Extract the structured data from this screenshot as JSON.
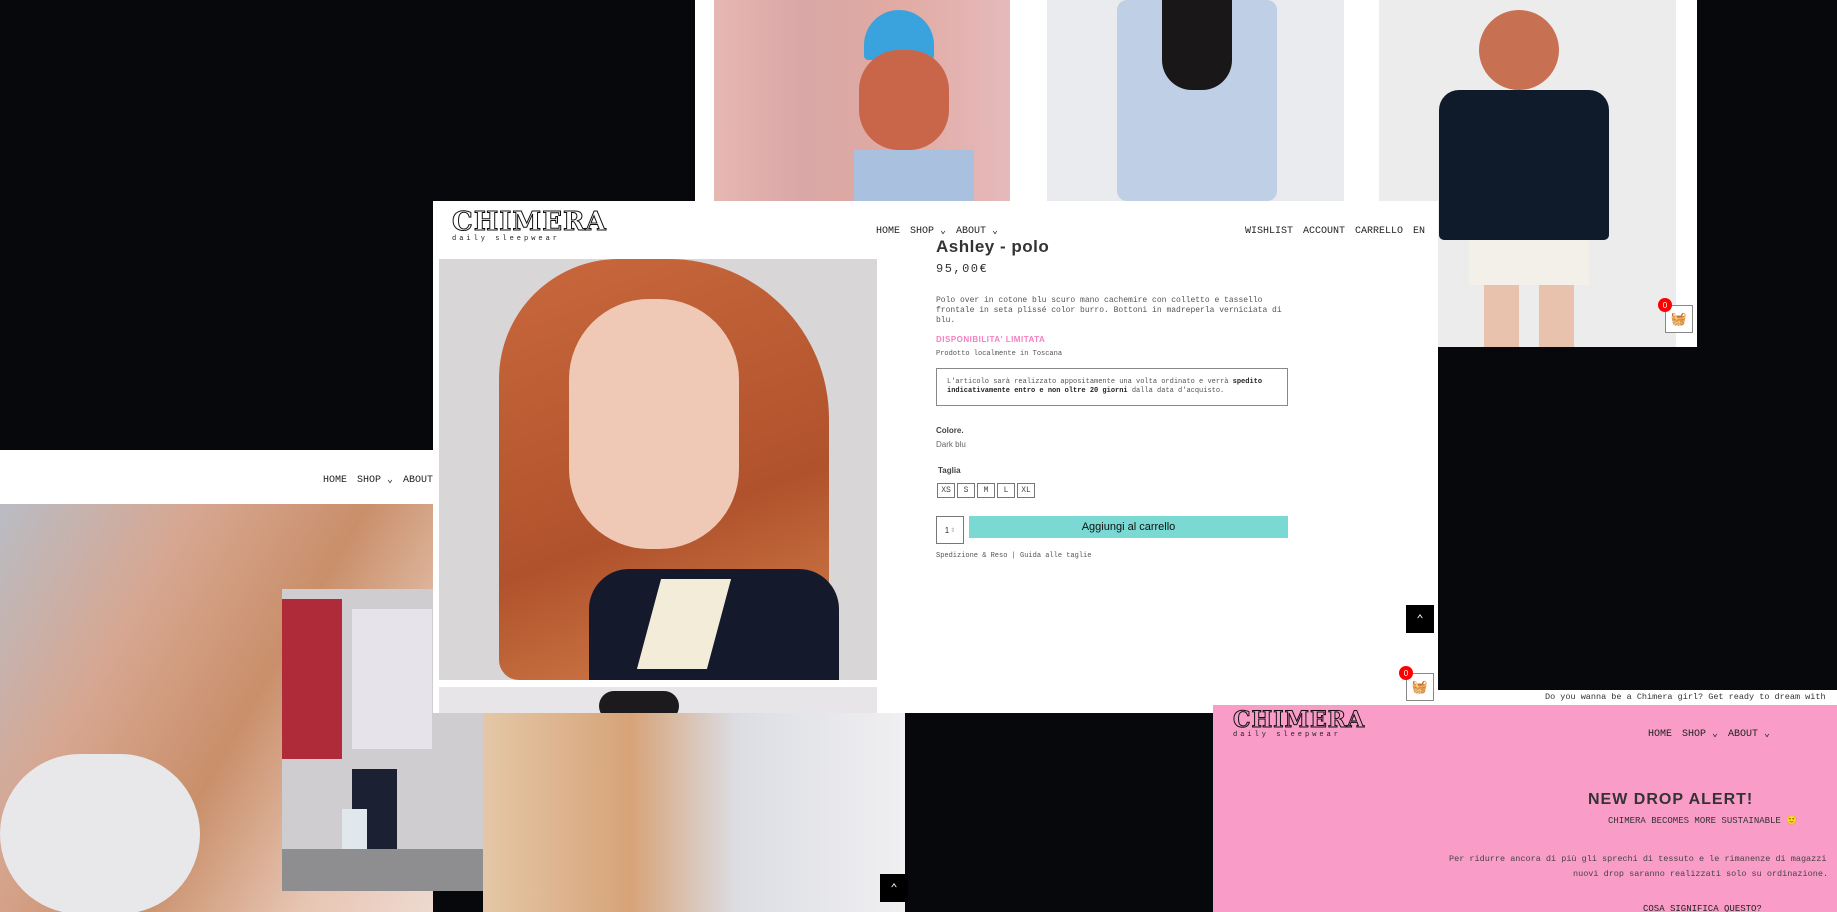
{
  "brand": {
    "logo": "CHIMERA",
    "tagline": "daily sleepwear"
  },
  "nav": {
    "home": "HOME",
    "shop": "SHOP ⌄",
    "about": "ABOUT ⌄",
    "about_plain": "ABOUT"
  },
  "header_right": {
    "wishlist": "WISHLIST",
    "account": "ACCOUNT",
    "cart": "CARRELLO",
    "lang": "EN"
  },
  "product": {
    "name": "Ashley - polo",
    "price": "95,00€",
    "description": "Polo over in cotone blu scuro mano cachemire con colletto e tassello frontale in seta plissé color burro. Bottoni in madreperla verniciata di blu.",
    "availability": "DISPONIBILITA' LIMITATA",
    "origin": "Prodotto localmente in Toscana",
    "notice_pre": "L'articolo sarà realizzato appositamente una volta ordinato e verrà ",
    "notice_bold": "spedito indicativamente entro e non oltre 20 giorni",
    "notice_post": " dalla data d'acquisto.",
    "color_label": "Colore.",
    "color_value": "Dark blu",
    "size_label": "Taglia",
    "sizes": [
      "XS",
      "S",
      "M",
      "L",
      "XL"
    ],
    "quantity": "1",
    "add_to_cart": "Aggiungi al carrello",
    "links": "Spedizione & Reso | Guida alle taglie"
  },
  "cart": {
    "count": "0"
  },
  "marquee": "Do you wanna be a Chimera girl? Get ready to dream with",
  "promo": {
    "title": "NEW DROP ALERT!",
    "subtitle": "CHIMERA BECOMES MORE SUSTAINABLE 🙂",
    "body1": "Per ridurre ancora di più gli sprechi di tessuto e le rimanenze di magazzi",
    "body2": "nuovi drop saranno realizzati solo su ordinazione.",
    "question": "COSA SIGNIFICA QUESTO?"
  },
  "colors": {
    "pink": "#f99dc8",
    "accent": "#7ad9d3",
    "availability": "#f57fc0",
    "badge": "#ff0000"
  }
}
